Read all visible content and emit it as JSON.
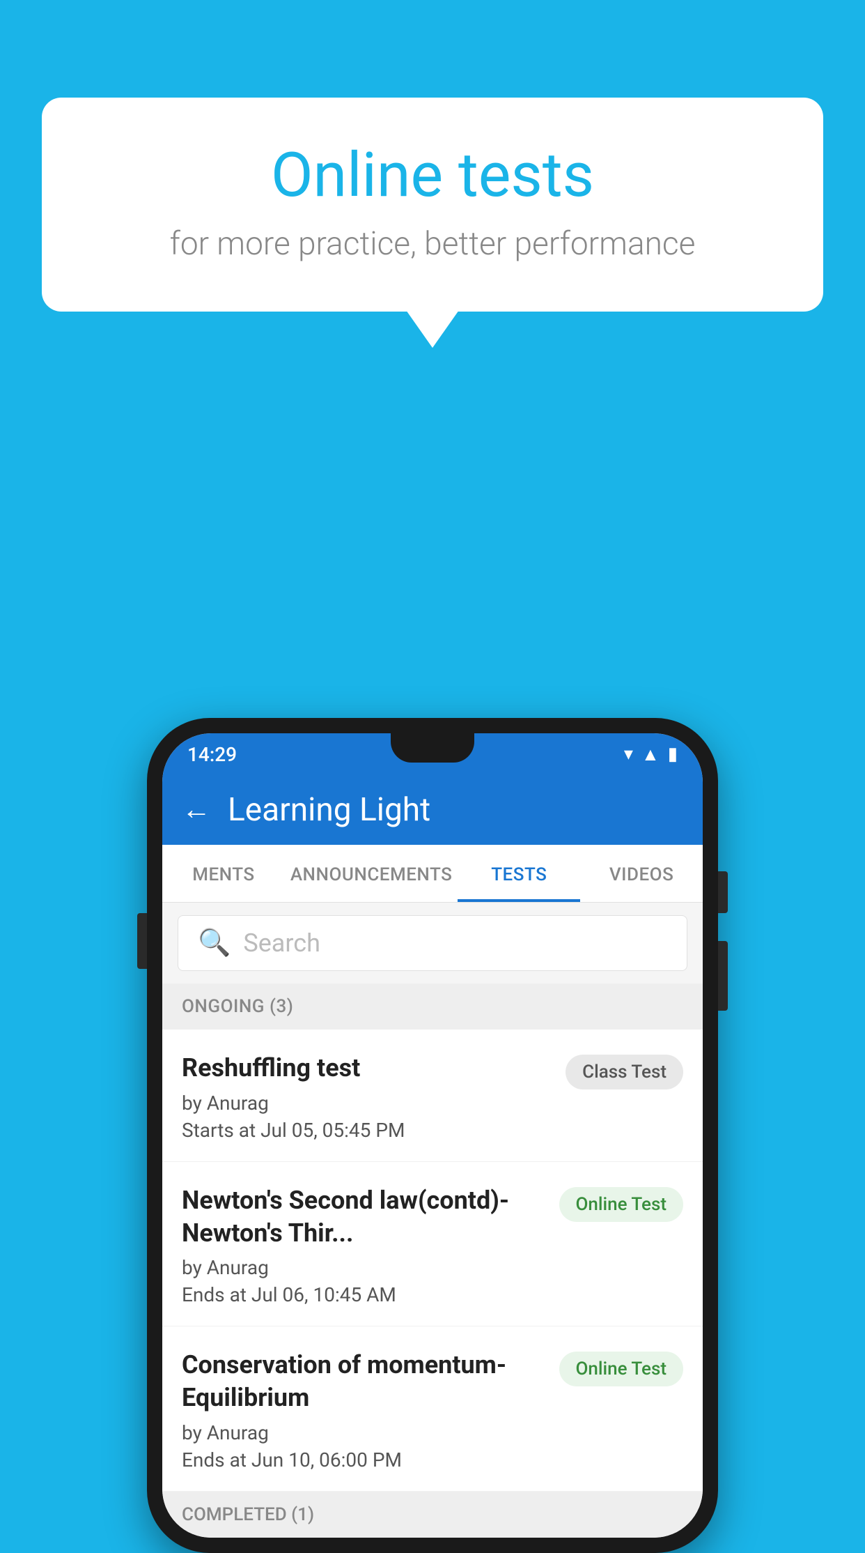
{
  "background_color": "#1ab4e8",
  "speech_bubble": {
    "title": "Online tests",
    "subtitle": "for more practice, better performance"
  },
  "phone": {
    "status_bar": {
      "time": "14:29",
      "icons": [
        "wifi",
        "signal",
        "battery"
      ]
    },
    "app_header": {
      "back_label": "←",
      "title": "Learning Light"
    },
    "tabs": [
      {
        "label": "MENTS",
        "active": false
      },
      {
        "label": "ANNOUNCEMENTS",
        "active": false
      },
      {
        "label": "TESTS",
        "active": true
      },
      {
        "label": "VIDEOS",
        "active": false
      }
    ],
    "search": {
      "placeholder": "Search"
    },
    "sections": [
      {
        "label": "ONGOING (3)",
        "tests": [
          {
            "name": "Reshuffling test",
            "author": "by Anurag",
            "time_label": "Starts at",
            "time": "Jul 05, 05:45 PM",
            "badge": "Class Test",
            "badge_type": "class"
          },
          {
            "name": "Newton's Second law(contd)-Newton's Thir...",
            "author": "by Anurag",
            "time_label": "Ends at",
            "time": "Jul 06, 10:45 AM",
            "badge": "Online Test",
            "badge_type": "online"
          },
          {
            "name": "Conservation of momentum-Equilibrium",
            "author": "by Anurag",
            "time_label": "Ends at",
            "time": "Jun 10, 06:00 PM",
            "badge": "Online Test",
            "badge_type": "online"
          }
        ]
      }
    ],
    "completed_section_label": "COMPLETED (1)"
  }
}
